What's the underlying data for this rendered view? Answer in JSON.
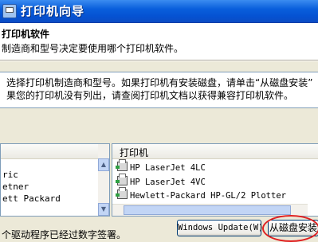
{
  "window": {
    "title": "打印机向导"
  },
  "header": {
    "title": "打印机软件",
    "subtitle": "制造商和型号决定要使用哪个打印机软件。"
  },
  "instructions": {
    "line1": "选择打印机制造商和型号。如果打印机有安装磁盘，请单击“从磁盘安装”",
    "line2": "果您的打印机没有列出，请查阅打印机文档以获得兼容打印机软件。"
  },
  "manufacturer_list": {
    "items": [
      "ric",
      "etner",
      "ett Packard"
    ]
  },
  "printer_list": {
    "header": "打印机",
    "items": [
      "HP LaserJet 4LC",
      "HP LaserJet 4VC",
      "Hewlett-Packard HP-GL/2 Plotter"
    ]
  },
  "footer": {
    "message": "个驱动程序已经过数字签署。",
    "windows_update_label": "Windows Update(W)",
    "have_disk_label": "从磁盘安装"
  },
  "icons": {
    "window_icon": "printer-wizard-icon",
    "printer_item_icon": "printer-icon"
  },
  "colors": {
    "titlebar": "#0553d3",
    "highlight_circle": "#e02020"
  }
}
